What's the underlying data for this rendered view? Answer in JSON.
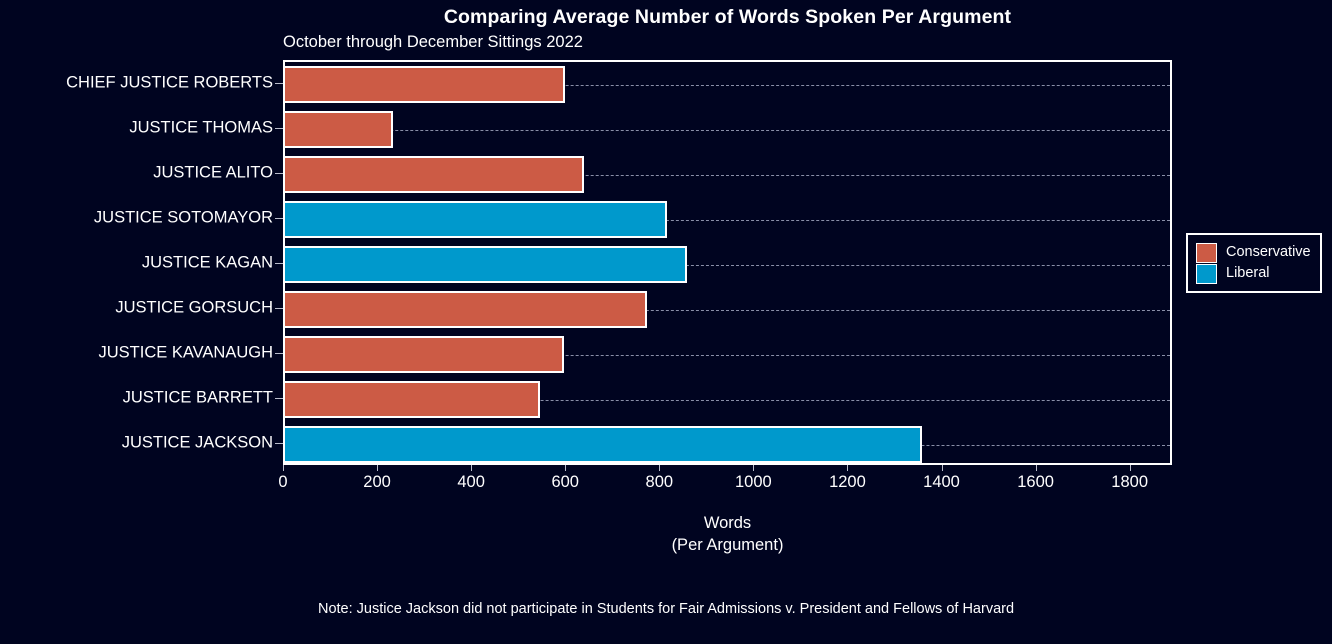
{
  "chart_data": {
    "type": "bar",
    "orientation": "horizontal",
    "title": "Comparing Average Number of Words Spoken Per Argument",
    "subtitle": "October through December Sittings 2022",
    "xlabel": "Words",
    "xlabel_line2": "(Per Argument)",
    "ylabel": "",
    "categories": [
      "CHIEF JUSTICE ROBERTS",
      "JUSTICE THOMAS",
      "JUSTICE ALITO",
      "JUSTICE SOTOMAYOR",
      "JUSTICE KAGAN",
      "JUSTICE GORSUCH",
      "JUSTICE KAVANAUGH",
      "JUSTICE BARRETT",
      "JUSTICE JACKSON"
    ],
    "values": [
      596,
      230,
      636,
      813,
      855,
      770,
      594,
      543,
      1355
    ],
    "groups": [
      "Conservative",
      "Conservative",
      "Conservative",
      "Liberal",
      "Liberal",
      "Conservative",
      "Conservative",
      "Conservative",
      "Liberal"
    ],
    "xlim": [
      0,
      1890
    ],
    "xticks": [
      0,
      200,
      400,
      600,
      800,
      1000,
      1200,
      1400,
      1600,
      1800
    ],
    "xtick_labels": [
      "0",
      "200",
      "400",
      "600",
      "800",
      "1000",
      "1200",
      "1400",
      "1600",
      "1800"
    ],
    "grid": "horizontal-dashed",
    "legend_position": "right-outside",
    "legend": [
      {
        "label": "Conservative",
        "color": "#CC5B45"
      },
      {
        "label": "Liberal",
        "color": "#0099CC"
      }
    ],
    "annotations": [
      "Note: Justice Jackson did not participate in Students for Fair Admissions v. President and Fellows of Harvard"
    ]
  },
  "colors": {
    "background": "#000420",
    "conservative": "#CC5B45",
    "liberal": "#0099CC",
    "axis": "#ffffff",
    "grid": "#8a8fa8",
    "text": "#ffffff"
  },
  "footnote": "Note: Justice Jackson did not participate in Students for Fair Admissions v. President and Fellows of Harvard"
}
